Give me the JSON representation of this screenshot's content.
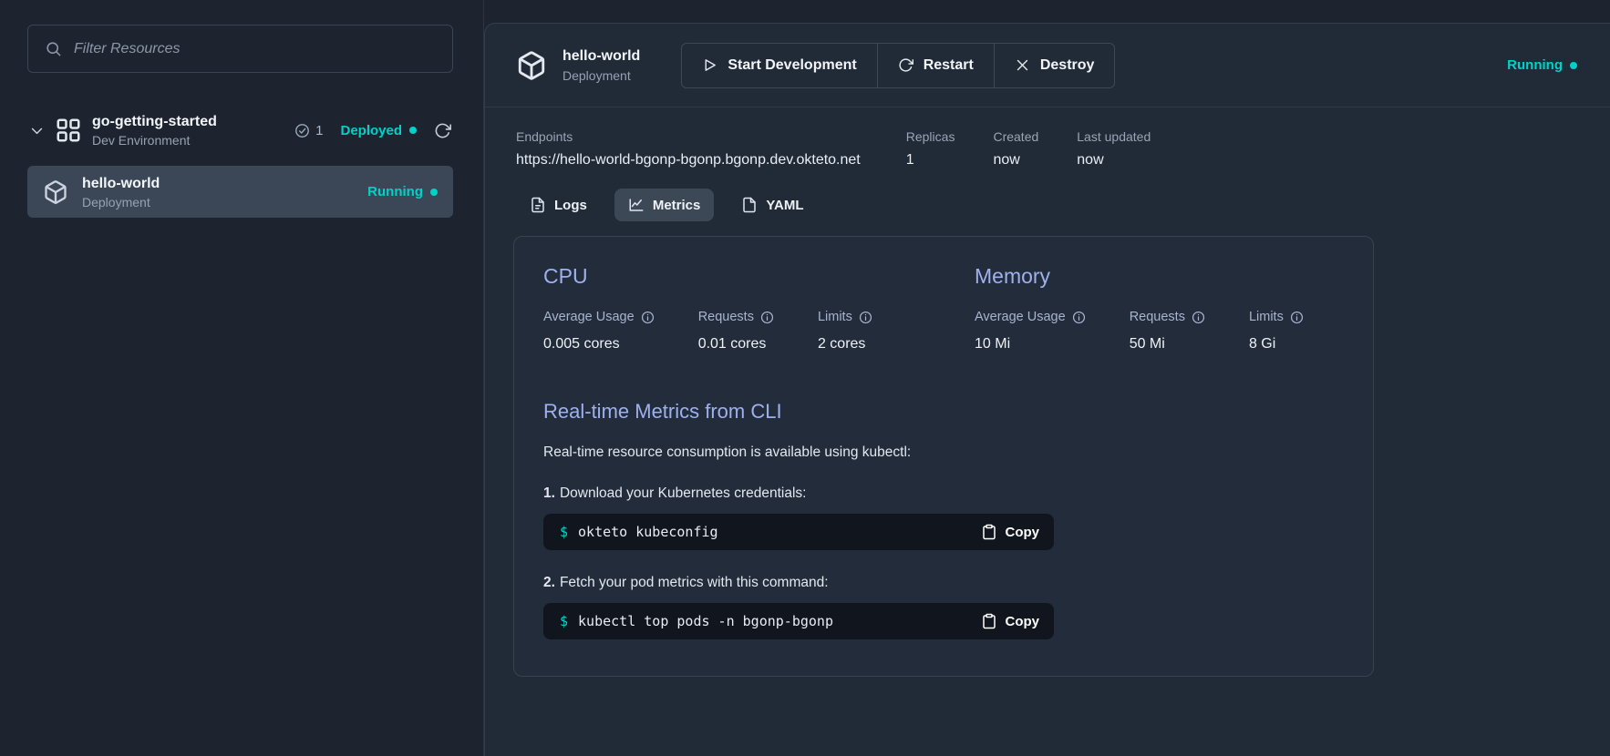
{
  "theme": {
    "accent_teal": "#00d2c8",
    "heading_blue": "#9fb0ee",
    "code_background": "#10151e"
  },
  "icons": {
    "search-icon": "magnifier",
    "chevron-down-icon": "chevron-down",
    "dev-environment-icon": "grid-of-squares",
    "check-circle-icon": "check-in-circle",
    "refresh-icon": "rotate-arrow",
    "deployment-icon": "cube-package",
    "play-icon": "play-triangle",
    "close-icon": "x-cross",
    "logs-icon": "file-text",
    "metrics-icon": "line-chart",
    "yaml-icon": "file-text",
    "info-icon": "info-circle",
    "copy-icon": "clipboard",
    "status-dot": "filled-circle"
  },
  "sidebar": {
    "filter_placeholder": "Filter Resources",
    "environment": {
      "name": "go-getting-started",
      "type": "Dev Environment",
      "count": "1",
      "status": "Deployed"
    },
    "resource": {
      "name": "hello-world",
      "type": "Deployment",
      "status": "Running"
    }
  },
  "main": {
    "title": "hello-world",
    "subtitle": "Deployment",
    "status": "Running",
    "actions": {
      "start": "Start Development",
      "restart": "Restart",
      "destroy": "Destroy"
    },
    "endpoints": {
      "label": "Endpoints",
      "url": "https://hello-world-bgonp-bgonp.bgonp.dev.okteto.net"
    },
    "meta": [
      {
        "label": "Replicas",
        "value": "1"
      },
      {
        "label": "Created",
        "value": "now"
      },
      {
        "label": "Last updated",
        "value": "now"
      }
    ],
    "tabs": [
      {
        "label": "Logs"
      },
      {
        "label": "Metrics"
      },
      {
        "label": "YAML"
      }
    ],
    "metrics": {
      "cpu": {
        "title": "CPU",
        "stats": [
          {
            "label": "Average Usage",
            "value": "0.005 cores"
          },
          {
            "label": "Requests",
            "value": "0.01 cores"
          },
          {
            "label": "Limits",
            "value": "2 cores"
          }
        ]
      },
      "memory": {
        "title": "Memory",
        "stats": [
          {
            "label": "Average Usage",
            "value": "10 Mi"
          },
          {
            "label": "Requests",
            "value": "50 Mi"
          },
          {
            "label": "Limits",
            "value": "8 Gi"
          }
        ]
      },
      "cli": {
        "title": "Real-time Metrics from CLI",
        "intro": "Real-time resource consumption is available using kubectl:",
        "prompt": "$",
        "steps": [
          {
            "number": "1.",
            "text": "Download your Kubernetes credentials:",
            "command": "okteto kubeconfig",
            "copy_label": "Copy"
          },
          {
            "number": "2.",
            "text": "Fetch your pod metrics with this command:",
            "command": "kubectl top pods -n bgonp-bgonp",
            "copy_label": "Copy"
          }
        ]
      }
    }
  }
}
